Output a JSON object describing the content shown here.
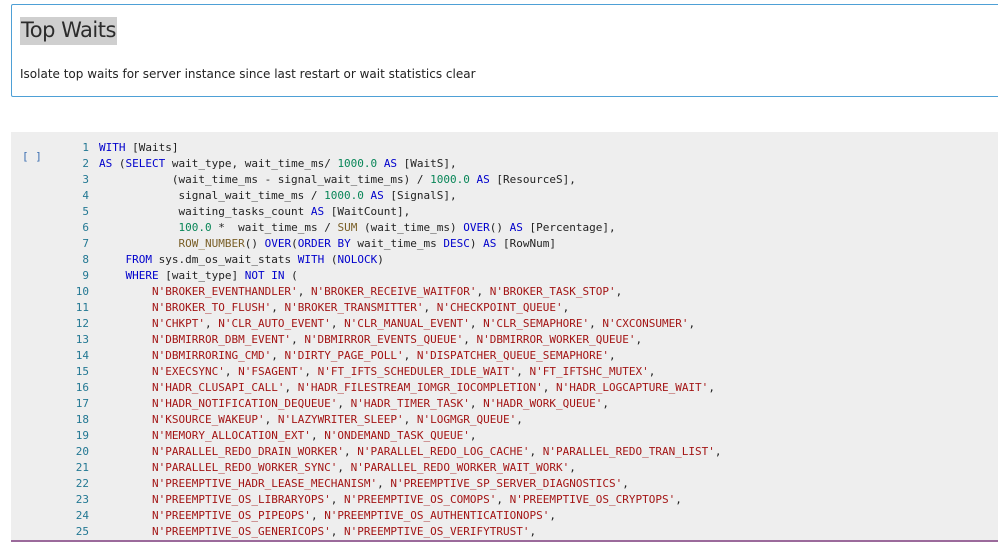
{
  "markdown": {
    "title": "Top Waits",
    "description": "Isolate top waits for server instance since last restart or wait statistics clear"
  },
  "code_cell": {
    "execution_count": "[ ]",
    "lines": [
      {
        "num": "1",
        "tokens": [
          {
            "t": "WITH",
            "c": "k"
          },
          {
            "t": " [Waits]",
            "c": ""
          }
        ]
      },
      {
        "num": "2",
        "tokens": [
          {
            "t": "AS",
            "c": "k"
          },
          {
            "t": " (",
            "c": ""
          },
          {
            "t": "SELECT",
            "c": "k"
          },
          {
            "t": " wait_type, wait_time_ms/ ",
            "c": ""
          },
          {
            "t": "1000.0",
            "c": "n"
          },
          {
            "t": " ",
            "c": ""
          },
          {
            "t": "AS",
            "c": "k"
          },
          {
            "t": " [WaitS],",
            "c": ""
          }
        ]
      },
      {
        "num": "3",
        "tokens": [
          {
            "t": "           (wait_time_ms - signal_wait_time_ms) / ",
            "c": ""
          },
          {
            "t": "1000.0",
            "c": "n"
          },
          {
            "t": " ",
            "c": ""
          },
          {
            "t": "AS",
            "c": "k"
          },
          {
            "t": " [ResourceS],",
            "c": ""
          }
        ]
      },
      {
        "num": "4",
        "tokens": [
          {
            "t": "            signal_wait_time_ms / ",
            "c": ""
          },
          {
            "t": "1000.0",
            "c": "n"
          },
          {
            "t": " ",
            "c": ""
          },
          {
            "t": "AS",
            "c": "k"
          },
          {
            "t": " [SignalS],",
            "c": ""
          }
        ]
      },
      {
        "num": "5",
        "tokens": [
          {
            "t": "            waiting_tasks_count ",
            "c": ""
          },
          {
            "t": "AS",
            "c": "k"
          },
          {
            "t": " [WaitCount],",
            "c": ""
          }
        ]
      },
      {
        "num": "6",
        "tokens": [
          {
            "t": "            ",
            "c": ""
          },
          {
            "t": "100.0",
            "c": "n"
          },
          {
            "t": " *  wait_time_ms / ",
            "c": ""
          },
          {
            "t": "SUM",
            "c": "f"
          },
          {
            "t": " (wait_time_ms) ",
            "c": ""
          },
          {
            "t": "OVER",
            "c": "k"
          },
          {
            "t": "() ",
            "c": ""
          },
          {
            "t": "AS",
            "c": "k"
          },
          {
            "t": " [Percentage],",
            "c": ""
          }
        ]
      },
      {
        "num": "7",
        "tokens": [
          {
            "t": "            ",
            "c": ""
          },
          {
            "t": "ROW_NUMBER",
            "c": "f"
          },
          {
            "t": "() ",
            "c": ""
          },
          {
            "t": "OVER",
            "c": "k"
          },
          {
            "t": "(",
            "c": ""
          },
          {
            "t": "ORDER BY",
            "c": "k"
          },
          {
            "t": " wait_time_ms ",
            "c": ""
          },
          {
            "t": "DESC",
            "c": "k"
          },
          {
            "t": ") ",
            "c": ""
          },
          {
            "t": "AS",
            "c": "k"
          },
          {
            "t": " [RowNum]",
            "c": ""
          }
        ]
      },
      {
        "num": "8",
        "tokens": [
          {
            "t": "    ",
            "c": ""
          },
          {
            "t": "FROM",
            "c": "k"
          },
          {
            "t": " sys.dm_os_wait_stats ",
            "c": ""
          },
          {
            "t": "WITH",
            "c": "k"
          },
          {
            "t": " (",
            "c": ""
          },
          {
            "t": "NOLOCK",
            "c": "k"
          },
          {
            "t": ")",
            "c": ""
          }
        ]
      },
      {
        "num": "9",
        "tokens": [
          {
            "t": "    ",
            "c": ""
          },
          {
            "t": "WHERE",
            "c": "k"
          },
          {
            "t": " [wait_type] ",
            "c": ""
          },
          {
            "t": "NOT IN",
            "c": "k"
          },
          {
            "t": " (",
            "c": ""
          }
        ]
      },
      {
        "num": "10",
        "tokens": [
          {
            "t": "        ",
            "c": ""
          },
          {
            "t": "N'BROKER_EVENTHANDLER'",
            "c": "s"
          },
          {
            "t": ", ",
            "c": ""
          },
          {
            "t": "N'BROKER_RECEIVE_WAITFOR'",
            "c": "s"
          },
          {
            "t": ", ",
            "c": ""
          },
          {
            "t": "N'BROKER_TASK_STOP'",
            "c": "s"
          },
          {
            "t": ",",
            "c": ""
          }
        ]
      },
      {
        "num": "11",
        "tokens": [
          {
            "t": "        ",
            "c": ""
          },
          {
            "t": "N'BROKER_TO_FLUSH'",
            "c": "s"
          },
          {
            "t": ", ",
            "c": ""
          },
          {
            "t": "N'BROKER_TRANSMITTER'",
            "c": "s"
          },
          {
            "t": ", ",
            "c": ""
          },
          {
            "t": "N'CHECKPOINT_QUEUE'",
            "c": "s"
          },
          {
            "t": ",",
            "c": ""
          }
        ]
      },
      {
        "num": "12",
        "tokens": [
          {
            "t": "        ",
            "c": ""
          },
          {
            "t": "N'CHKPT'",
            "c": "s"
          },
          {
            "t": ", ",
            "c": ""
          },
          {
            "t": "N'CLR_AUTO_EVENT'",
            "c": "s"
          },
          {
            "t": ", ",
            "c": ""
          },
          {
            "t": "N'CLR_MANUAL_EVENT'",
            "c": "s"
          },
          {
            "t": ", ",
            "c": ""
          },
          {
            "t": "N'CLR_SEMAPHORE'",
            "c": "s"
          },
          {
            "t": ", ",
            "c": ""
          },
          {
            "t": "N'CXCONSUMER'",
            "c": "s"
          },
          {
            "t": ",",
            "c": ""
          }
        ]
      },
      {
        "num": "13",
        "tokens": [
          {
            "t": "        ",
            "c": ""
          },
          {
            "t": "N'DBMIRROR_DBM_EVENT'",
            "c": "s"
          },
          {
            "t": ", ",
            "c": ""
          },
          {
            "t": "N'DBMIRROR_EVENTS_QUEUE'",
            "c": "s"
          },
          {
            "t": ", ",
            "c": ""
          },
          {
            "t": "N'DBMIRROR_WORKER_QUEUE'",
            "c": "s"
          },
          {
            "t": ",",
            "c": ""
          }
        ]
      },
      {
        "num": "14",
        "tokens": [
          {
            "t": "        ",
            "c": ""
          },
          {
            "t": "N'DBMIRRORING_CMD'",
            "c": "s"
          },
          {
            "t": ", ",
            "c": ""
          },
          {
            "t": "N'DIRTY_PAGE_POLL'",
            "c": "s"
          },
          {
            "t": ", ",
            "c": ""
          },
          {
            "t": "N'DISPATCHER_QUEUE_SEMAPHORE'",
            "c": "s"
          },
          {
            "t": ",",
            "c": ""
          }
        ]
      },
      {
        "num": "15",
        "tokens": [
          {
            "t": "        ",
            "c": ""
          },
          {
            "t": "N'EXECSYNC'",
            "c": "s"
          },
          {
            "t": ", ",
            "c": ""
          },
          {
            "t": "N'FSAGENT'",
            "c": "s"
          },
          {
            "t": ", ",
            "c": ""
          },
          {
            "t": "N'FT_IFTS_SCHEDULER_IDLE_WAIT'",
            "c": "s"
          },
          {
            "t": ", ",
            "c": ""
          },
          {
            "t": "N'FT_IFTSHC_MUTEX'",
            "c": "s"
          },
          {
            "t": ",",
            "c": ""
          }
        ]
      },
      {
        "num": "16",
        "tokens": [
          {
            "t": "        ",
            "c": ""
          },
          {
            "t": "N'HADR_CLUSAPI_CALL'",
            "c": "s"
          },
          {
            "t": ", ",
            "c": ""
          },
          {
            "t": "N'HADR_FILESTREAM_IOMGR_IOCOMPLETION'",
            "c": "s"
          },
          {
            "t": ", ",
            "c": ""
          },
          {
            "t": "N'HADR_LOGCAPTURE_WAIT'",
            "c": "s"
          },
          {
            "t": ",",
            "c": ""
          }
        ]
      },
      {
        "num": "17",
        "tokens": [
          {
            "t": "        ",
            "c": ""
          },
          {
            "t": "N'HADR_NOTIFICATION_DEQUEUE'",
            "c": "s"
          },
          {
            "t": ", ",
            "c": ""
          },
          {
            "t": "N'HADR_TIMER_TASK'",
            "c": "s"
          },
          {
            "t": ", ",
            "c": ""
          },
          {
            "t": "N'HADR_WORK_QUEUE'",
            "c": "s"
          },
          {
            "t": ",",
            "c": ""
          }
        ]
      },
      {
        "num": "18",
        "tokens": [
          {
            "t": "        ",
            "c": ""
          },
          {
            "t": "N'KSOURCE_WAKEUP'",
            "c": "s"
          },
          {
            "t": ", ",
            "c": ""
          },
          {
            "t": "N'LAZYWRITER_SLEEP'",
            "c": "s"
          },
          {
            "t": ", ",
            "c": ""
          },
          {
            "t": "N'LOGMGR_QUEUE'",
            "c": "s"
          },
          {
            "t": ",",
            "c": ""
          }
        ]
      },
      {
        "num": "19",
        "tokens": [
          {
            "t": "        ",
            "c": ""
          },
          {
            "t": "N'MEMORY_ALLOCATION_EXT'",
            "c": "s"
          },
          {
            "t": ", ",
            "c": ""
          },
          {
            "t": "N'ONDEMAND_TASK_QUEUE'",
            "c": "s"
          },
          {
            "t": ",",
            "c": ""
          }
        ]
      },
      {
        "num": "20",
        "tokens": [
          {
            "t": "        ",
            "c": ""
          },
          {
            "t": "N'PARALLEL_REDO_DRAIN_WORKER'",
            "c": "s"
          },
          {
            "t": ", ",
            "c": ""
          },
          {
            "t": "N'PARALLEL_REDO_LOG_CACHE'",
            "c": "s"
          },
          {
            "t": ", ",
            "c": ""
          },
          {
            "t": "N'PARALLEL_REDO_TRAN_LIST'",
            "c": "s"
          },
          {
            "t": ",",
            "c": ""
          }
        ]
      },
      {
        "num": "21",
        "tokens": [
          {
            "t": "        ",
            "c": ""
          },
          {
            "t": "N'PARALLEL_REDO_WORKER_SYNC'",
            "c": "s"
          },
          {
            "t": ", ",
            "c": ""
          },
          {
            "t": "N'PARALLEL_REDO_WORKER_WAIT_WORK'",
            "c": "s"
          },
          {
            "t": ",",
            "c": ""
          }
        ]
      },
      {
        "num": "22",
        "tokens": [
          {
            "t": "        ",
            "c": ""
          },
          {
            "t": "N'PREEMPTIVE_HADR_LEASE_MECHANISM'",
            "c": "s"
          },
          {
            "t": ", ",
            "c": ""
          },
          {
            "t": "N'PREEMPTIVE_SP_SERVER_DIAGNOSTICS'",
            "c": "s"
          },
          {
            "t": ",",
            "c": ""
          }
        ]
      },
      {
        "num": "23",
        "tokens": [
          {
            "t": "        ",
            "c": ""
          },
          {
            "t": "N'PREEMPTIVE_OS_LIBRARYOPS'",
            "c": "s"
          },
          {
            "t": ", ",
            "c": ""
          },
          {
            "t": "N'PREEMPTIVE_OS_COMOPS'",
            "c": "s"
          },
          {
            "t": ", ",
            "c": ""
          },
          {
            "t": "N'PREEMPTIVE_OS_CRYPTOPS'",
            "c": "s"
          },
          {
            "t": ",",
            "c": ""
          }
        ]
      },
      {
        "num": "24",
        "tokens": [
          {
            "t": "        ",
            "c": ""
          },
          {
            "t": "N'PREEMPTIVE_OS_PIPEOPS'",
            "c": "s"
          },
          {
            "t": ", ",
            "c": ""
          },
          {
            "t": "N'PREEMPTIVE_OS_AUTHENTICATIONOPS'",
            "c": "s"
          },
          {
            "t": ",",
            "c": ""
          }
        ]
      },
      {
        "num": "25",
        "tokens": [
          {
            "t": "        ",
            "c": ""
          },
          {
            "t": "N'PREEMPTIVE_OS_GENERICOPS'",
            "c": "s"
          },
          {
            "t": ", ",
            "c": ""
          },
          {
            "t": "N'PREEMPTIVE_OS_VERIFYTRUST'",
            "c": "s"
          },
          {
            "t": ",",
            "c": ""
          }
        ]
      }
    ]
  }
}
